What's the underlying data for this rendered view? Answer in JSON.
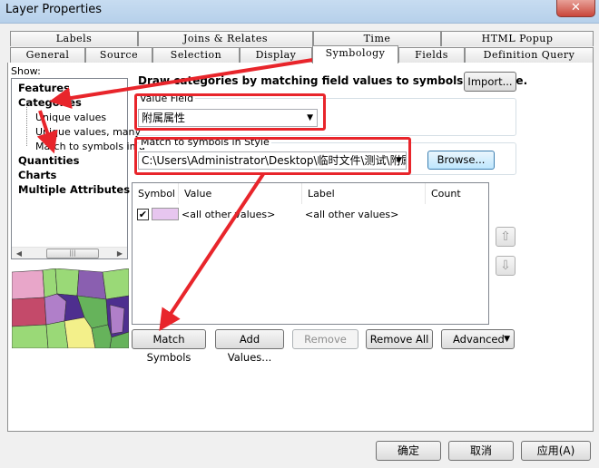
{
  "window": {
    "title": "Layer Properties",
    "close_glyph": "✕"
  },
  "tabs_row1": [
    "Labels",
    "Joins & Relates",
    "Time",
    "HTML Popup"
  ],
  "tabs_row2": [
    "General",
    "Source",
    "Selection",
    "Display",
    "Symbology",
    "Fields",
    "Definition Query"
  ],
  "active_tab": "Symbology",
  "show": {
    "label": "Show:",
    "items": [
      "Features",
      "Categories",
      "Unique values",
      "Unique values, many",
      "Match to symbols in a",
      "Quantities",
      "Charts",
      "Multiple Attributes"
    ]
  },
  "description": "Draw categories by matching field values to symbols in a style.",
  "import_label": "Import...",
  "value_field": {
    "label": "Value Field",
    "value": "附属属性"
  },
  "match_style": {
    "label": "Match to symbols in Style",
    "value": "C:\\Users\\Administrator\\Desktop\\临时文件\\测试\\附属.st"
  },
  "browse_label": "Browse...",
  "table": {
    "columns": [
      "Symbol",
      "Value",
      "Label",
      "Count"
    ],
    "rows": [
      {
        "value": "<all other values>",
        "label": "<all other values>",
        "count": "",
        "symbol_color": "#e7c6ef",
        "checked": true
      }
    ]
  },
  "buttons": {
    "match_symbols": "Match Symbols",
    "add_values": "Add Values...",
    "remove": "Remove",
    "remove_all": "Remove All",
    "advanced": "Advanced"
  },
  "footer": {
    "ok": "确定",
    "cancel": "取消",
    "apply": "应用(A)"
  },
  "colors": {
    "annotation_red": "#e8252b",
    "preview_colors": [
      "#e8a6c9",
      "#9ad977",
      "#8a5fb0",
      "#b07fc9",
      "#c44a6a",
      "#f3f08a",
      "#4e2f8f",
      "#66b35b",
      "#e9a84a"
    ]
  }
}
